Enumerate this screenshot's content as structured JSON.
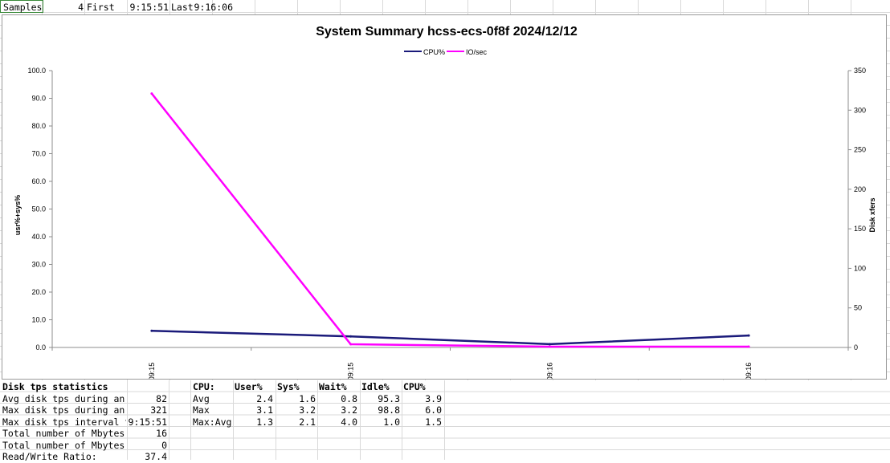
{
  "top_row": {
    "samples_label": "Samples",
    "samples_value": "4",
    "first_label": "First",
    "first_value": "9:15:51",
    "last_label": "Last",
    "last_value": "9:16:06"
  },
  "chart_data": {
    "type": "line",
    "title": "System Summary hcss-ecs-0f8f  2024/12/12",
    "categories": [
      "09:15",
      "09:15",
      "09:16",
      "09:16"
    ],
    "ylabel_left": "usr%+sys%",
    "ylabel_right": "Disk xfers",
    "ylim_left": [
      0,
      100
    ],
    "ylim_right": [
      0,
      350
    ],
    "left_ticks": [
      "0.0",
      "10.0",
      "20.0",
      "30.0",
      "40.0",
      "50.0",
      "60.0",
      "70.0",
      "80.0",
      "90.0",
      "100.0"
    ],
    "right_ticks": [
      "0",
      "50",
      "100",
      "150",
      "200",
      "250",
      "300",
      "350"
    ],
    "legend_position": "top-center",
    "series": [
      {
        "name": "CPU%",
        "axis": "left",
        "color": "#1a1a7a",
        "values": [
          6.0,
          4.0,
          1.2,
          4.3
        ]
      },
      {
        "name": "IO/sec",
        "axis": "right",
        "color": "#ff00ff",
        "values": [
          321,
          4,
          1,
          1
        ]
      }
    ]
  },
  "disk_stats": {
    "title": "Disk tps statistics",
    "rows": [
      {
        "label": "Avg disk tps during an int",
        "value": "82"
      },
      {
        "label": "Max disk tps during an int",
        "value": "321"
      },
      {
        "label": "Max disk tps interval time",
        "value": "9:15:51"
      },
      {
        "label": "Total number of Mbytes rea",
        "value": "16"
      },
      {
        "label": "Total number of Mbytes wri",
        "value": "0"
      },
      {
        "label": "Read/Write Ratio:",
        "value": "37.4"
      }
    ]
  },
  "cpu_stats": {
    "headers": [
      "CPU:",
      "User%",
      "Sys%",
      "Wait%",
      "Idle%",
      "CPU%"
    ],
    "rows": [
      {
        "label": "Avg",
        "values": [
          "2.4",
          "1.6",
          "0.8",
          "95.3",
          "3.9"
        ]
      },
      {
        "label": "Max",
        "values": [
          "3.1",
          "3.2",
          "3.2",
          "98.8",
          "6.0"
        ]
      },
      {
        "label": "Max:Avg",
        "values": [
          "1.3",
          "2.1",
          "4.0",
          "1.0",
          "1.5"
        ]
      }
    ]
  }
}
